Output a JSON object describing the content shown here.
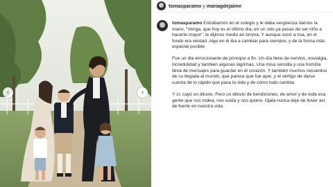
{
  "header": {
    "user1": "tomasparamo",
    "joiner": "y",
    "user2": "mariagdejaime"
  },
  "caption": {
    "username": "tomasparamo",
    "p1": "Entrábamos en el colegio y le daba vergüenza darnos la mano. “Venga, que hoy es el último día, en un rato ya pasas de ser niño a hacerte mayor”, le dijimos medio en broma. Y aunque sonó a risa, en el fondo era verdad. Algo en él iba a cambiar para siempre, y de la forma más especial posible.",
    "p2": "Fue un día emocionante de principio a fin. Un día lleno de nervios, nostalgia, incredulidad y también algunas lágrimas. Una misa sencilla y una homilía llena de mensajes para guardar en el corazón. Y también muchos recuerdos de su llegada al mundo, que parece que fue ayer, y el vértigo de darse cuenta de lo rápido que pasa la vida y de cómo todo cambia.",
    "p3": "Y sí, cayó un diluvio. Pero un diluvio de bendiciones, de amor y de toda esa gente que nos rodea, nos cuida y nos quiere. Ojalá nunca deje de llover así de fuerte en nuestra vida."
  },
  "colors": {
    "text": "#262626",
    "border": "#efefef",
    "avatar": "#2d2d2d"
  },
  "icons": {
    "prev": "chevron-left-icon",
    "next": "chevron-right-icon"
  }
}
